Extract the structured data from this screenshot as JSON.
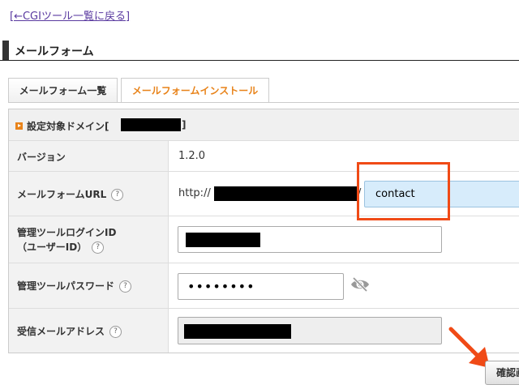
{
  "back_link": "[←CGIツール一覧に戻る]",
  "section_title": "メールフォーム",
  "tabs": [
    {
      "label": "メールフォーム一覧",
      "active": false
    },
    {
      "label": "メールフォームインストール",
      "active": true
    }
  ],
  "domain_row": {
    "label": "設定対象ドメイン[",
    "close": "]"
  },
  "form": {
    "version": {
      "label": "バージョン",
      "value": "1.2.0"
    },
    "url": {
      "label": "メールフォームURL",
      "prefix": "http://",
      "slash": "/",
      "value": "contact"
    },
    "login_id": {
      "label_line1": "管理ツールログインID",
      "label_line2": "（ユーザーID）"
    },
    "password": {
      "label": "管理ツールパスワード",
      "value": "••••••••"
    },
    "email": {
      "label": "受信メールアドレス"
    }
  },
  "help_glyph": "?",
  "confirm_button": "確認画面へ進む",
  "colors": {
    "accent": "#e8831a",
    "highlight": "#f04a16",
    "link": "#5a3aa0"
  }
}
